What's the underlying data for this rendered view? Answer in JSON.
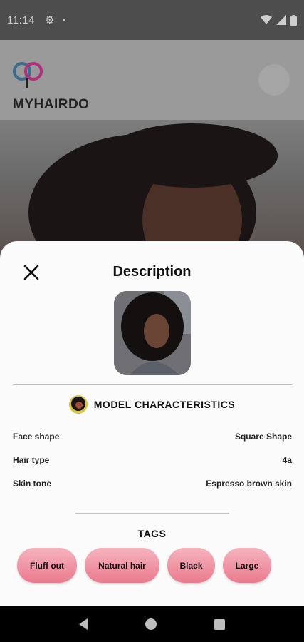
{
  "status_bar": {
    "time": "11:14"
  },
  "app": {
    "logo_text": "MYHAIRDO"
  },
  "sheet": {
    "title": "Description",
    "characteristics_title": "MODEL CHARACTERISTICS",
    "attributes": [
      {
        "label": "Face shape",
        "value": "Square Shape"
      },
      {
        "label": "Hair type",
        "value": "4a"
      },
      {
        "label": "Skin tone",
        "value": "Espresso brown skin"
      }
    ],
    "tags_title": "TAGS",
    "tags": [
      "Fluff out",
      "Natural hair",
      "Black",
      "Large"
    ]
  },
  "colors": {
    "tag_gradient_top": "#f6b3bf",
    "tag_gradient_bottom": "#ea7b8e",
    "sheet_bg": "#fbfbfb"
  },
  "icons": {
    "close": "close-icon",
    "back": "back-triangle-icon",
    "home": "home-circle-icon",
    "recent": "recents-square-icon"
  }
}
